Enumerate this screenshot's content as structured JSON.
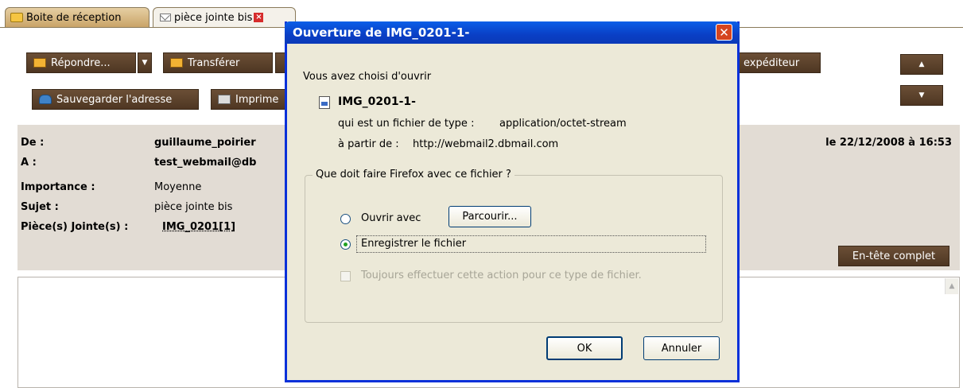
{
  "tabs": [
    {
      "label": "Boite de réception"
    },
    {
      "label": "pièce jointe bis"
    }
  ],
  "toolbar": {
    "reply": "Répondre...",
    "forward": "Transférer",
    "sender": "expéditeur",
    "save_address": "Sauvegarder l'adresse",
    "print": "Imprime"
  },
  "header": {
    "from_label": "De :",
    "from_value": "guillaume_poirier",
    "to_label": "A :",
    "to_value": "test_webmail@db",
    "importance_label": "Importance :",
    "importance_value": "Moyenne",
    "subject_label": "Sujet :",
    "subject_value": "pièce jointe bis",
    "attachments_label": "Pièce(s) Jointe(s) :",
    "attachments_value": "IMG_0201[1]",
    "date": "le 22/12/2008 à 16:53",
    "full_header_button": "En-tête complet"
  },
  "dialog": {
    "title": "Ouverture de IMG_0201-1-",
    "intro": "Vous avez choisi d'ouvrir",
    "filename": "IMG_0201-1-",
    "type_label": "qui est un fichier de type :",
    "type_value": "application/octet-stream",
    "from_label": "à partir de :",
    "from_value": "http://webmail2.dbmail.com",
    "question": "Que doit faire Firefox avec ce fichier ?",
    "open_with": "Ouvrir avec",
    "browse": "Parcourir...",
    "save_file": "Enregistrer le fichier",
    "always": "Toujours effectuer cette action pour ce type de fichier.",
    "ok": "OK",
    "cancel": "Annuler"
  }
}
